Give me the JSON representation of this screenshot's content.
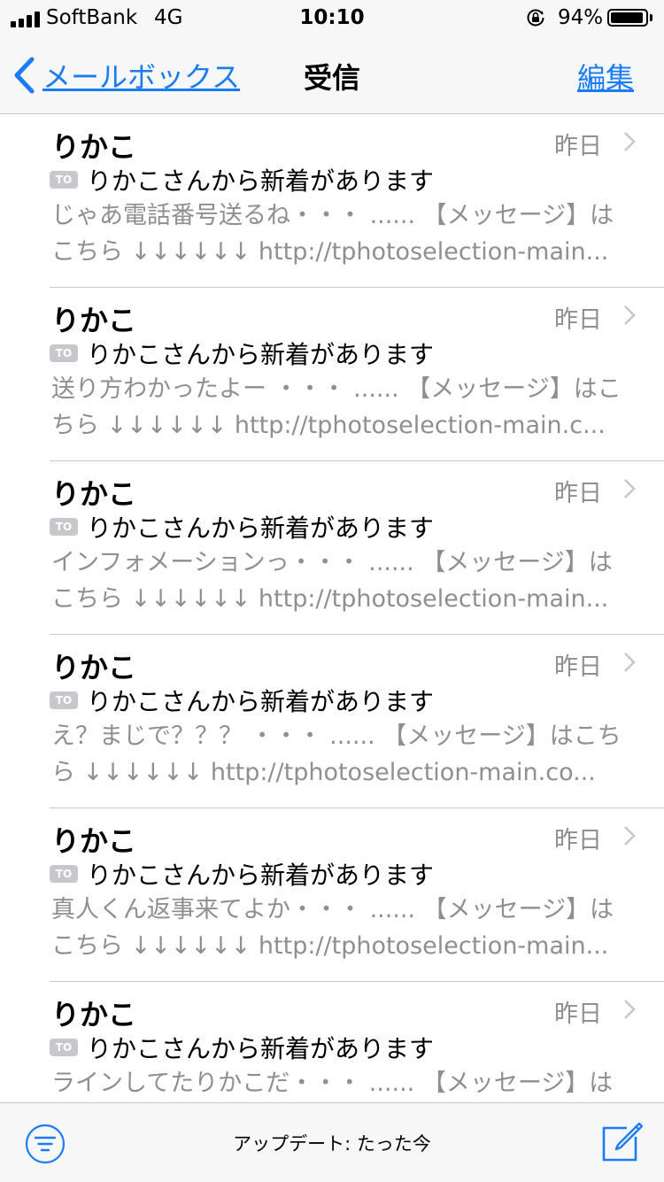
{
  "status_bar": {
    "carrier": "SoftBank",
    "network": "4G",
    "time": "10:10",
    "battery_percent": "94%",
    "battery_level": 0.94,
    "icons": [
      "signal-icon",
      "rotation-lock-icon",
      "battery-icon"
    ]
  },
  "nav": {
    "back_label": "メールボックス",
    "title": "受信",
    "edit_label": "編集",
    "accent_color": "#1a7cf5"
  },
  "badge_label": "TO",
  "messages": [
    {
      "sender": "りかこ",
      "date": "昨日",
      "subject": "りかこさんから新着があります",
      "preview_line1": "じゃあ電話番号送るね・・・ ...... 【メッセージ】は",
      "preview_line2": "こちら ↓↓↓↓↓↓ http://tphotoselection-main..."
    },
    {
      "sender": "りかこ",
      "date": "昨日",
      "subject": "りかこさんから新着があります",
      "preview_line1": "送り方わかったよー ・・・ ...... 【メッセージ】はこ",
      "preview_line2": "ちら ↓↓↓↓↓↓ http://tphotoselection-main.c..."
    },
    {
      "sender": "りかこ",
      "date": "昨日",
      "subject": "りかこさんから新着があります",
      "preview_line1": "インフォメーションっ・・・ ...... 【メッセージ】は",
      "preview_line2": "こちら ↓↓↓↓↓↓ http://tphotoselection-main..."
    },
    {
      "sender": "りかこ",
      "date": "昨日",
      "subject": "りかこさんから新着があります",
      "preview_line1": "え？まじで？？？ ・・・ ...... 【メッセージ】はこち",
      "preview_line2": "ら ↓↓↓↓↓↓ http://tphotoselection-main.co..."
    },
    {
      "sender": "りかこ",
      "date": "昨日",
      "subject": "りかこさんから新着があります",
      "preview_line1": "真人くん返事来てよか・・・ ...... 【メッセージ】は",
      "preview_line2": "こちら ↓↓↓↓↓↓ http://tphotoselection-main..."
    },
    {
      "sender": "りかこ",
      "date": "昨日",
      "subject": "りかこさんから新着があります",
      "preview_line1": "ラインしてたりかこだ・・・ ...... 【メッセージ】は",
      "preview_line2": ""
    }
  ],
  "toolbar": {
    "update_status": "アップデート: たった今",
    "icons": [
      "filter-icon",
      "compose-icon"
    ]
  }
}
